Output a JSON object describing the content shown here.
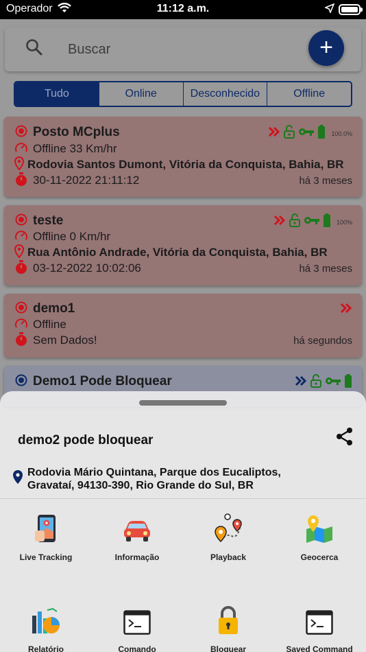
{
  "status_bar": {
    "carrier": "Operador",
    "time": "11:12 a.m."
  },
  "search": {
    "placeholder": "Buscar"
  },
  "add_button": {
    "label": "+"
  },
  "filters": [
    "Tudo",
    "Online",
    "Desconhecido",
    "Offline"
  ],
  "active_filter": "Tudo",
  "vehicles": [
    {
      "name": "Posto MCplus",
      "status": "Offline 33 Km/hr",
      "address": "Rodovia Santos Dumont, Vitória da Conquista, Bahia, BR",
      "datetime": "30-11-2022 21:11:12",
      "ago": "há 3 meses",
      "battery": "100.0%"
    },
    {
      "name": "teste",
      "status": "Offline 0 Km/hr",
      "address": "Rua Antônio Andrade, Vitória da Conquista, Bahia, BR",
      "datetime": "03-12-2022 10:02:06",
      "ago": "há 3 meses",
      "battery": "100%"
    },
    {
      "name": "demo1",
      "status": "Offline",
      "datetime": "Sem Dados!",
      "ago": "há segundos"
    },
    {
      "name": "Demo1 Pode Bloquear"
    }
  ],
  "sheet": {
    "title": "demo2 pode bloquear",
    "address": "Rodovia Mário Quintana, Parque dos Eucaliptos, Gravataí, 94130-390, Rio Grande do Sul, BR",
    "actions": [
      {
        "label": "Live Tracking",
        "icon": "phone-map-icon"
      },
      {
        "label": "Informação",
        "icon": "car-icon"
      },
      {
        "label": "Playback",
        "icon": "route-pins-icon"
      },
      {
        "label": "Geocerca",
        "icon": "map-pin-icon"
      },
      {
        "label": "Relatório",
        "icon": "report-chart-icon"
      },
      {
        "label": "Comando",
        "icon": "terminal-icon"
      },
      {
        "label": "Bloquear",
        "icon": "padlock-icon"
      },
      {
        "label": "Saved Command",
        "icon": "terminal-icon"
      }
    ]
  },
  "colors": {
    "primary": "#0d2a66",
    "offline_card": "#967575",
    "alert_red": "#d0141c",
    "ok_green": "#1c7a1c"
  }
}
